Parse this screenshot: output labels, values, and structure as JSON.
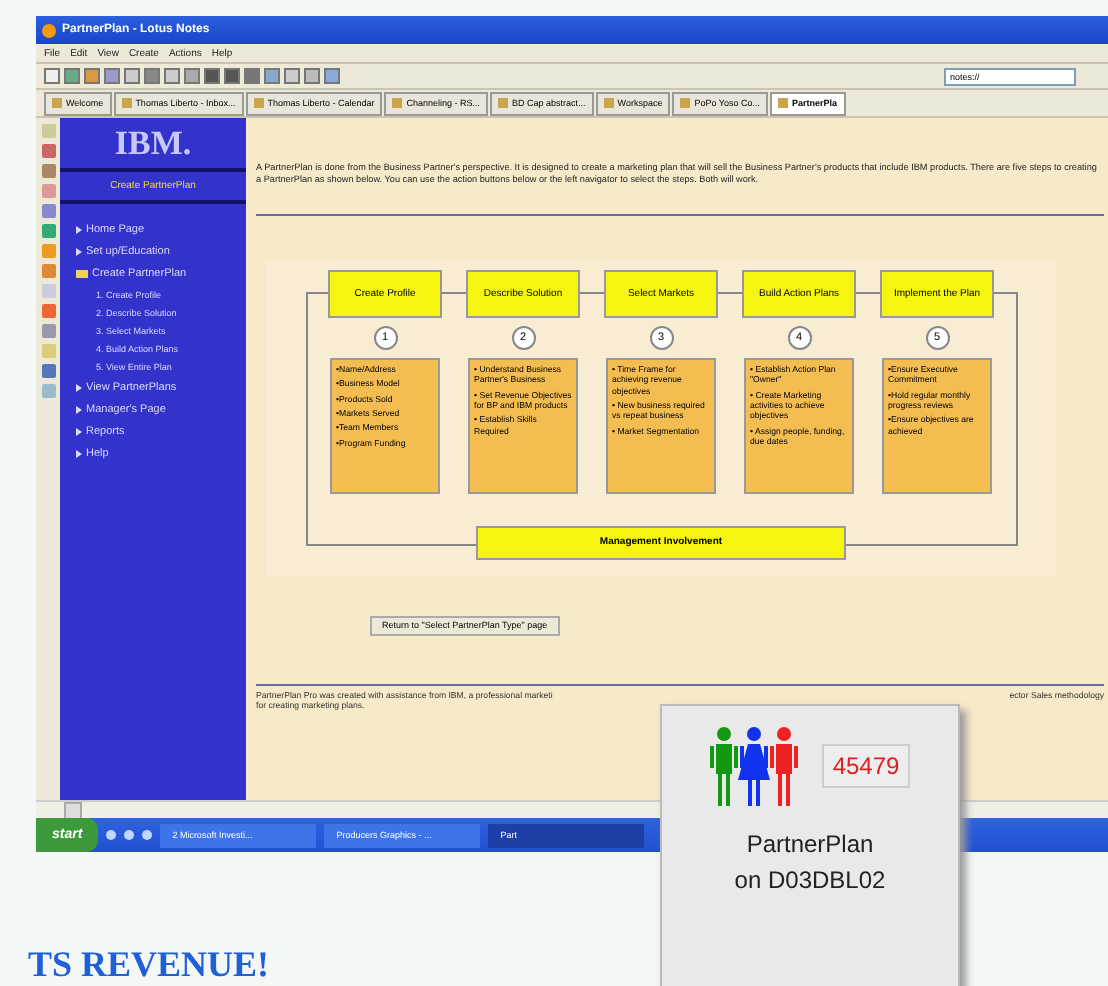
{
  "window": {
    "title": "PartnerPlan - Lotus Notes"
  },
  "menu": [
    "File",
    "Edit",
    "View",
    "Create",
    "Actions",
    "Help"
  ],
  "address": {
    "value": "notes://"
  },
  "tabs": [
    {
      "label": "Welcome",
      "selected": false
    },
    {
      "label": "Thomas Liberto - Inbox...",
      "selected": false
    },
    {
      "label": "Thomas Liberto - Calendar",
      "selected": false
    },
    {
      "label": "Channeling - RS...",
      "selected": false
    },
    {
      "label": "BD Cap abstract...",
      "selected": false
    },
    {
      "label": "Workspace",
      "selected": false
    },
    {
      "label": "PoPo Yoso Co...",
      "selected": false
    },
    {
      "label": "PartnerPla",
      "selected": true
    }
  ],
  "sidebar": {
    "logo": "IBM.",
    "header": "Create PartnerPlan",
    "items": [
      {
        "label": "Home Page",
        "expanded": false
      },
      {
        "label": "Set up/Education",
        "expanded": false
      },
      {
        "label": "Create PartnerPlan",
        "expanded": true,
        "children": [
          {
            "label": "1. Create Profile"
          },
          {
            "label": "2. Describe Solution"
          },
          {
            "label": "3. Select Markets"
          },
          {
            "label": "4. Build Action Plans"
          },
          {
            "label": "5. View Entire Plan"
          }
        ]
      },
      {
        "label": "View PartnerPlans",
        "expanded": false
      },
      {
        "label": "Manager's Page",
        "expanded": false
      },
      {
        "label": "Reports",
        "expanded": false
      },
      {
        "label": "Help",
        "expanded": false
      }
    ]
  },
  "intro": "A PartnerPlan is done from the Business Partner's perspective.  It is designed to create a marketing plan that will sell the Business Partner's products that include IBM products.  There are five steps to creating a PartnerPlan as shown below.  You can use the action buttons below or the left navigator to select the steps.  Both will work.",
  "steps": [
    {
      "title": "Create Profile",
      "number": "1",
      "points": [
        "•Name/Address",
        "•Business Model",
        "•Products Sold",
        "•Markets Served",
        "•Team Members",
        "•Program Funding"
      ]
    },
    {
      "title": "Describe Solution",
      "number": "2",
      "points": [
        "• Understand Business Partner's Business",
        "• Set Revenue Objectives for BP and IBM products",
        "• Establish Skills Required"
      ]
    },
    {
      "title": "Select Markets",
      "number": "3",
      "points": [
        "• Time Frame for achieving revenue objectives",
        "• New business required vs repeat business",
        "• Market Segmentation"
      ]
    },
    {
      "title": "Build Action Plans",
      "number": "4",
      "points": [
        "• Establish Action Plan \"Owner\"",
        "• Create Marketing activities to achieve objectives",
        "• Assign people, funding, due dates"
      ]
    },
    {
      "title": "Implement the Plan",
      "number": "5",
      "points": [
        "•Ensure Executive Commitment",
        "•Hold regular monthly progress reviews",
        "•Ensure objectives are achieved"
      ]
    }
  ],
  "management": "Management Involvement",
  "return_button": "Return to \"Select PartnerPlan Type\" page",
  "footer": {
    "left": "PartnerPlan Pro was created with assistance from IBM, a professional marketi",
    "left_line_2": "for creating marketing plans.",
    "right": "ector Sales methodology"
  },
  "taskbar": {
    "start": "start",
    "tasks": [
      {
        "label": "2 Microsoft Investi...",
        "selected": false
      },
      {
        "label": "Producers Graphics - ...",
        "selected": false
      },
      {
        "label": "Part",
        "selected": true
      }
    ]
  },
  "popup": {
    "count": "45479",
    "title": "PartnerPlan",
    "subtitle": "on D03DBL02"
  },
  "slogan": "TS REVENUE!"
}
